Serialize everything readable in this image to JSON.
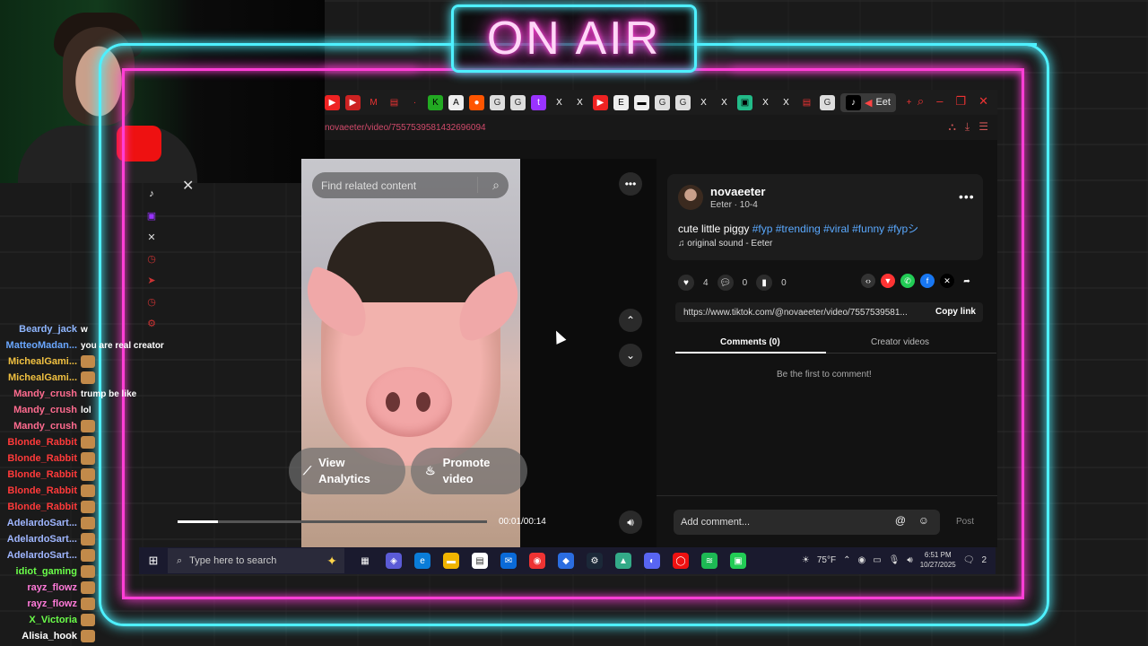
{
  "overlay": {
    "sign": "ON AIR"
  },
  "browser": {
    "url": "novaeeter/video/7557539581432696094",
    "active_tab_label": "Eet"
  },
  "video": {
    "search_placeholder": "Find related content",
    "view_analytics": "View\nAnalytics",
    "promote_video": "Promote\nvideo",
    "time": "00:01/00:14",
    "progress_fraction": 0.13
  },
  "post": {
    "username": "novaeeter",
    "subline": "Eeter · 10-4",
    "caption_text": "cute little piggy",
    "hashtags": "#fyp #trending #viral #funny #fypシ",
    "sound": "original sound - Eeter",
    "likes": "4",
    "comments": "0",
    "saves": "0",
    "link": "https://www.tiktok.com/@novaeeter/video/7557539581...",
    "copy_link": "Copy link",
    "tab_comments": "Comments (0)",
    "tab_creator": "Creator videos",
    "empty_state": "Be the first to comment!",
    "add_comment_placeholder": "Add comment...",
    "post_label": "Post"
  },
  "chat": [
    {
      "name": "Beardy_jack",
      "msg": "w",
      "color": "#8fb6ff"
    },
    {
      "name": "MatteoMadan...",
      "msg": "you are real creator",
      "color": "#6aa7ff"
    },
    {
      "name": "MichealGami...",
      "msg": "",
      "color": "#f0c040",
      "emoji": true
    },
    {
      "name": "MichealGami...",
      "msg": "",
      "color": "#f0c040",
      "emoji": true
    },
    {
      "name": "Mandy_crush",
      "msg": "trump be like",
      "color": "#ff6b8f"
    },
    {
      "name": "Mandy_crush",
      "msg": "lol",
      "color": "#ff6b8f"
    },
    {
      "name": "Mandy_crush",
      "msg": "",
      "color": "#ff6b8f",
      "emoji": true
    },
    {
      "name": "Blonde_Rabbit",
      "msg": "",
      "color": "#ff3a3a",
      "emoji": true
    },
    {
      "name": "Blonde_Rabbit",
      "msg": "",
      "color": "#ff3a3a",
      "emoji": true
    },
    {
      "name": "Blonde_Rabbit",
      "msg": "",
      "color": "#ff3a3a",
      "emoji": true
    },
    {
      "name": "Blonde_Rabbit",
      "msg": "",
      "color": "#ff3a3a",
      "emoji": true
    },
    {
      "name": "Blonde_Rabbit",
      "msg": "",
      "color": "#ff3a3a",
      "emoji": true
    },
    {
      "name": "AdelardoSart...",
      "msg": "",
      "color": "#9fb6ff",
      "emoji": true
    },
    {
      "name": "AdelardoSart...",
      "msg": "",
      "color": "#9fb6ff",
      "emoji": true
    },
    {
      "name": "AdelardoSart...",
      "msg": "",
      "color": "#9fb6ff",
      "emoji": true
    },
    {
      "name": "idiot_gaming",
      "msg": "",
      "color": "#6bff4a",
      "emoji": true
    },
    {
      "name": "rayz_flowz",
      "msg": "",
      "color": "#ff7ad9",
      "emoji": true
    },
    {
      "name": "rayz_flowz",
      "msg": "",
      "color": "#ff7ad9",
      "emoji": true
    },
    {
      "name": "X_Victoria",
      "msg": "",
      "color": "#6bff4a",
      "emoji": true
    },
    {
      "name": "Alisia_hook",
      "msg": "",
      "color": "#ffffff",
      "emoji": true
    }
  ],
  "taskbar": {
    "search_placeholder": "Type here to search",
    "weather": "75°F",
    "time": "6:51 PM",
    "date": "10/27/2025",
    "notif_count": "2"
  }
}
